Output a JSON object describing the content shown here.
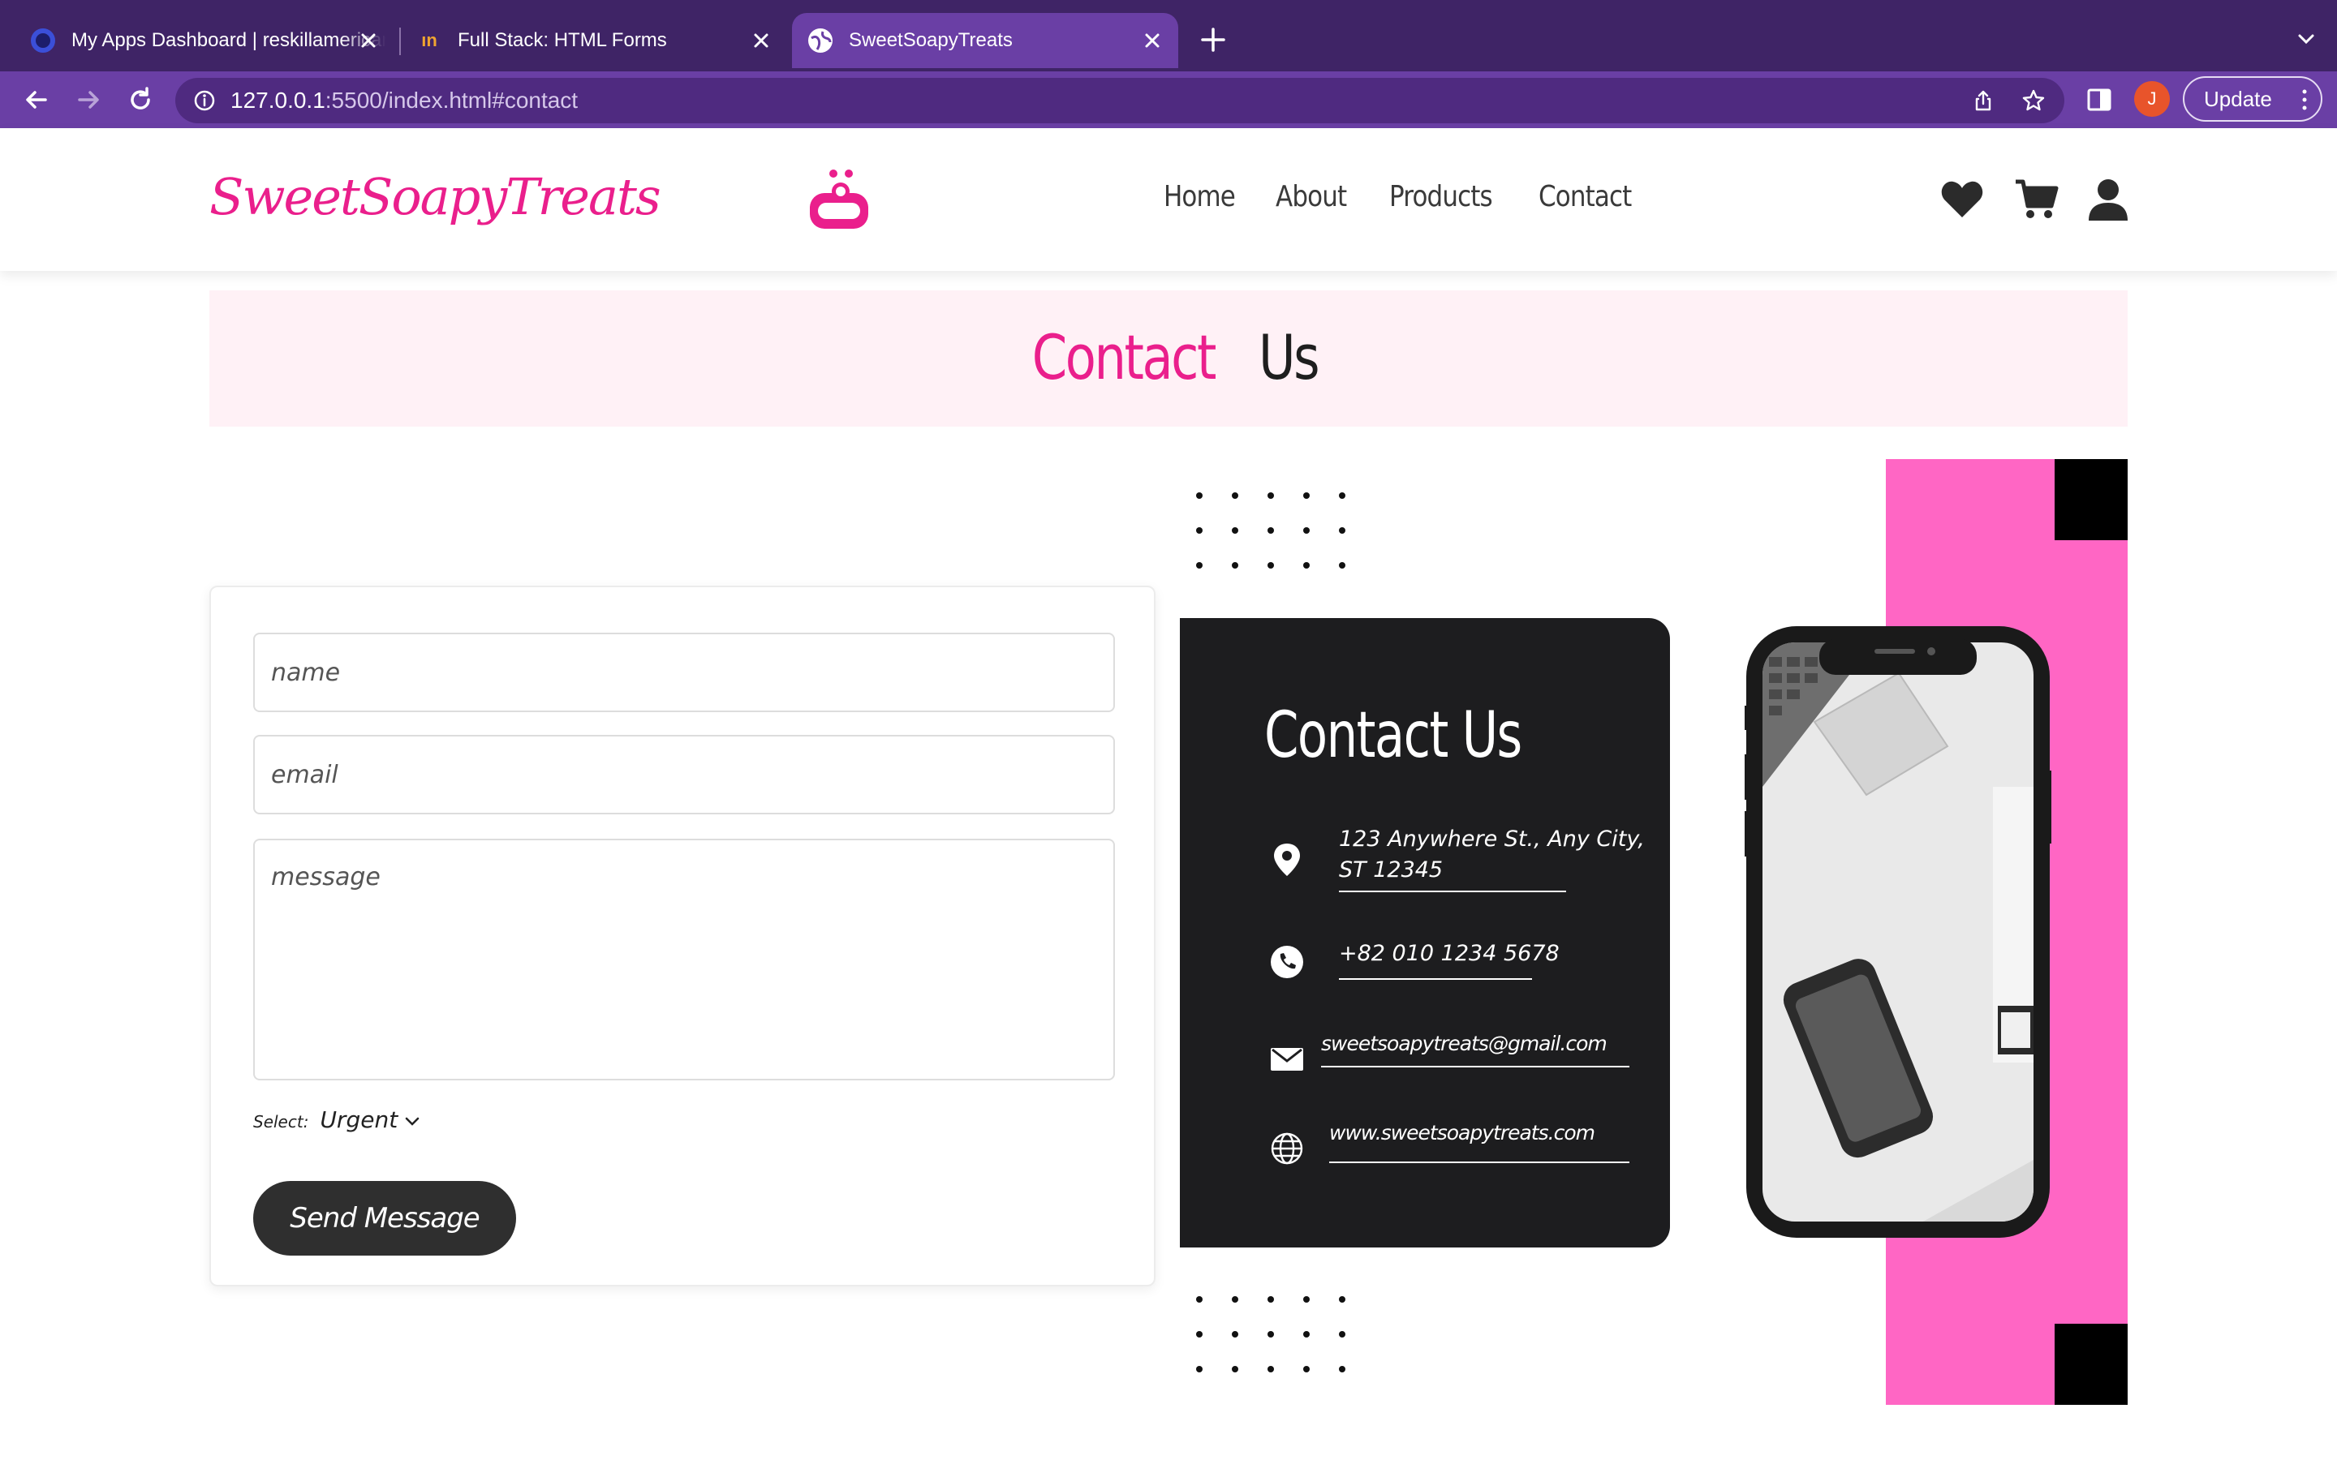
{
  "browser": {
    "tabs": [
      {
        "title": "My Apps Dashboard | reskillamericans",
        "active": false
      },
      {
        "title": "Full Stack: HTML Forms",
        "active": false
      },
      {
        "title": "SweetSoapyTreats",
        "active": true
      }
    ],
    "url_host": "127.0.0.1",
    "url_rest": ":5500/index.html#contact",
    "profile_initial": "J",
    "update_label": "Update"
  },
  "header": {
    "brand": "SweetSoapyTreats",
    "nav": [
      "Home",
      "About",
      "Products",
      "Contact"
    ]
  },
  "banner": {
    "title_highlight": "Contact",
    "title_rest": "Us"
  },
  "form": {
    "name_placeholder": "name",
    "email_placeholder": "email",
    "message_placeholder": "message",
    "select_label": "Select:",
    "select_value": "Urgent",
    "submit_label": "Send Message"
  },
  "info_card": {
    "title": "Contact Us",
    "address_line1": "123 Anywhere St., Any City,",
    "address_line2": "ST 12345",
    "phone": "+82 010 1234 5678",
    "email": "sweetsoapytreats@gmail.com",
    "website": "www.sweetsoapytreats.com"
  },
  "colors": {
    "brand_pink": "#ea1f8c",
    "accent_pink": "#ff66c4",
    "dark": "#1d1d1f",
    "browser_purple": "#6a3fa5"
  },
  "icons": {
    "header": [
      "heart-icon",
      "cart-icon",
      "user-icon"
    ],
    "info": [
      "location-pin-icon",
      "phone-icon",
      "mail-icon",
      "globe-icon"
    ]
  }
}
